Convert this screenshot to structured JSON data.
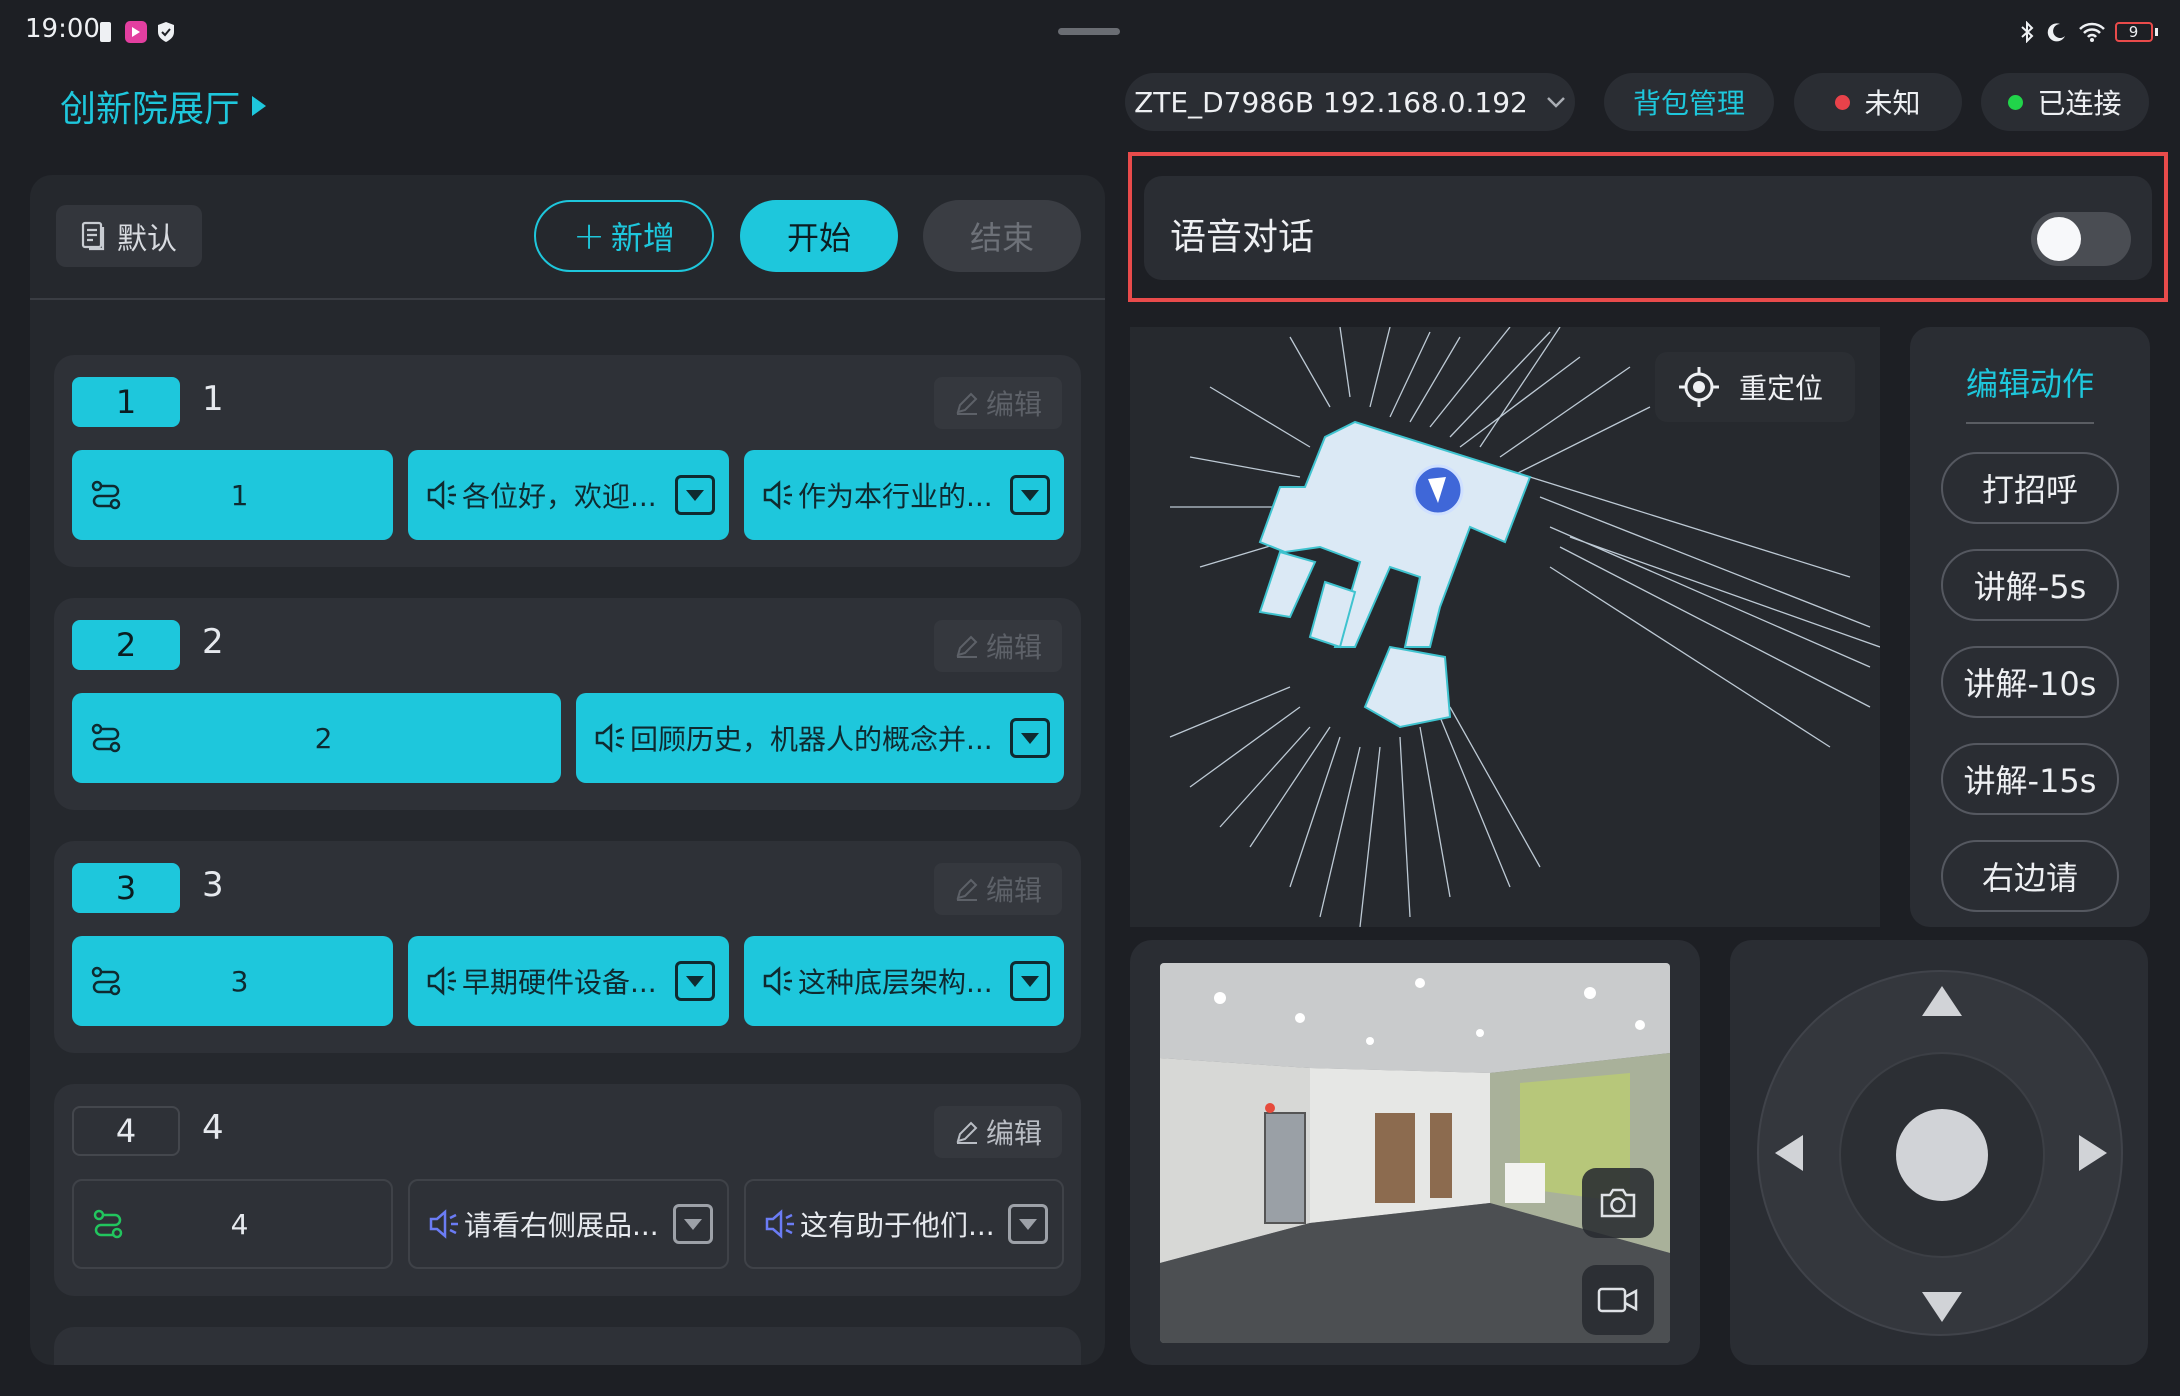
{
  "status_bar": {
    "time": "19:00",
    "battery": "9"
  },
  "header": {
    "venue": "创新院展厅",
    "network": "ZTE_D7986B 192.168.0.192",
    "backpack": "背包管理",
    "status_unknown": "未知",
    "status_connected": "已连接",
    "colors": {
      "accent": "#1ec7dc",
      "unknown_dot": "#e8424a",
      "connected_dot": "#21d44a"
    }
  },
  "left": {
    "default_label": "默认",
    "add_label": "新增",
    "add_prefix": "+",
    "start_label": "开始",
    "end_label": "结束",
    "edit_label": "编辑",
    "cards": [
      {
        "badge": "1",
        "title": "1",
        "route": "1",
        "speech": [
          "各位好，欢迎...",
          "作为本行业的..."
        ]
      },
      {
        "badge": "2",
        "title": "2",
        "route": "2",
        "speech": [
          "回顾历史，机器人的概念并..."
        ]
      },
      {
        "badge": "3",
        "title": "3",
        "route": "3",
        "speech": [
          "早期硬件设备...",
          "这种底层架构..."
        ]
      },
      {
        "badge": "4",
        "title": "4",
        "route": "4",
        "speech": [
          "请看右侧展品...",
          "这有助于他们..."
        ]
      }
    ]
  },
  "voice": {
    "label": "语音对话",
    "enabled": false
  },
  "map": {
    "relocate_label": "重定位"
  },
  "actions": {
    "title": "编辑动作",
    "items": [
      "打招呼",
      "讲解-5s",
      "讲解-10s",
      "讲解-15s",
      "右边请"
    ]
  }
}
